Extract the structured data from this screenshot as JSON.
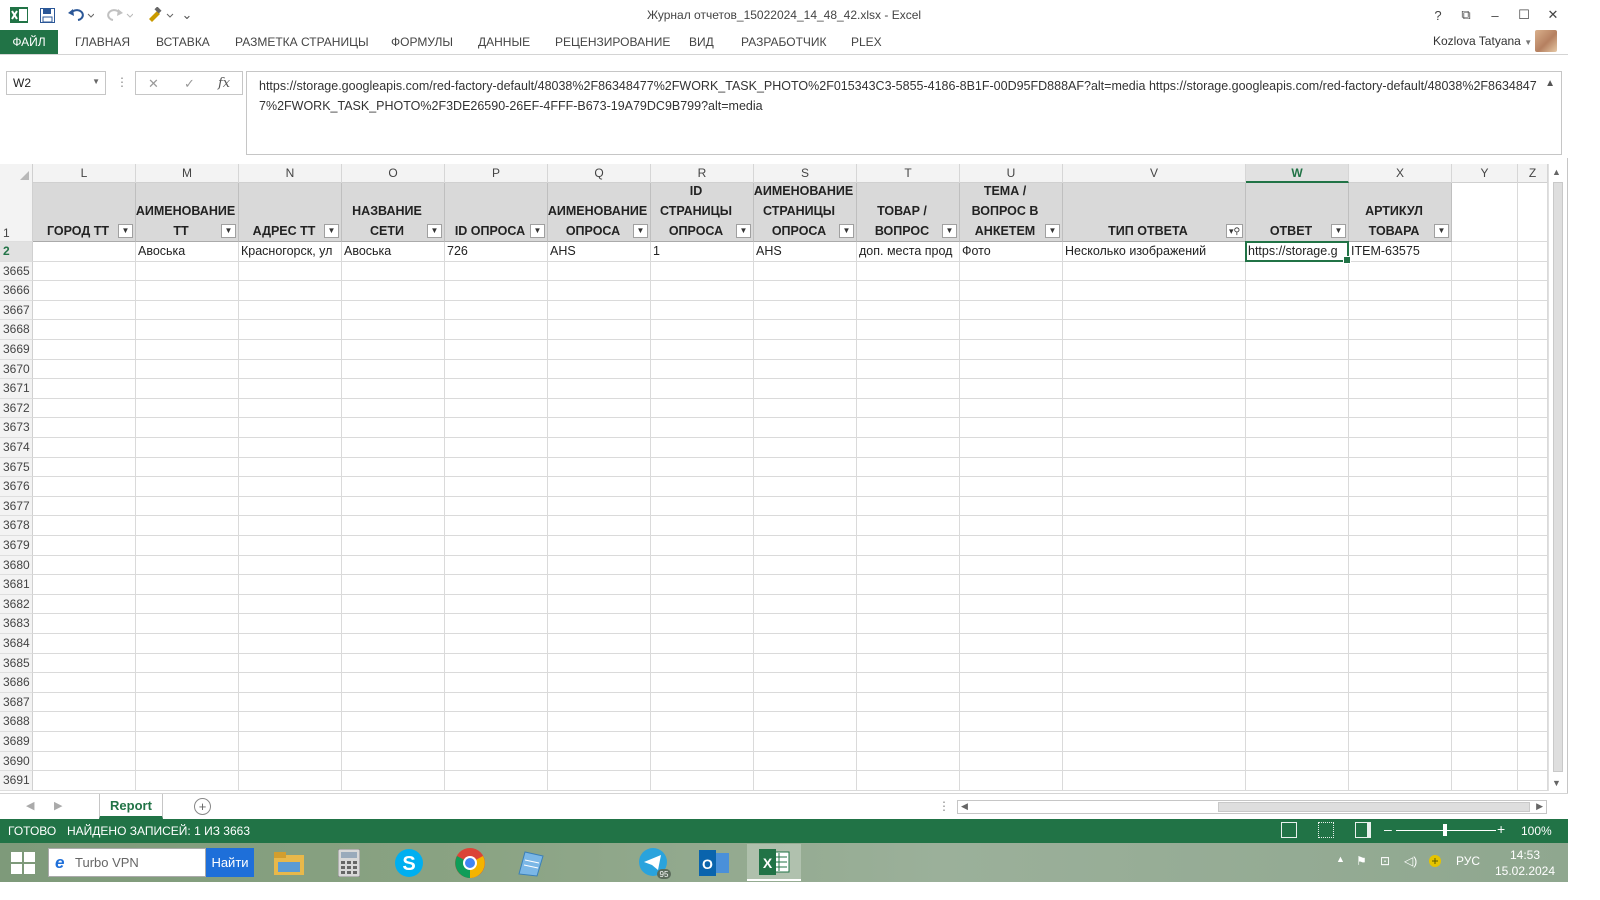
{
  "window": {
    "title": "Журнал отчетов_15022024_14_48_42.xlsx - Excel",
    "help": "?",
    "controls": {
      "restore_ribbon": "⧉",
      "minimize": "–",
      "maximize": "☐",
      "close": "✕"
    }
  },
  "quick_access": {
    "save": "save-icon",
    "undo": "undo-icon",
    "redo": "redo-icon",
    "format_painter": "format-painter-icon",
    "customize": "⌄"
  },
  "ribbon": {
    "file": "ФАЙЛ",
    "tabs": [
      "ГЛАВНАЯ",
      "ВСТАВКА",
      "РАЗМЕТКА СТРАНИЦЫ",
      "ФОРМУЛЫ",
      "ДАННЫЕ",
      "РЕЦЕНЗИРОВАНИЕ",
      "ВИД",
      "РАЗРАБОТЧИК",
      "PLEX"
    ],
    "user": "Kozlova Tatyana"
  },
  "formula_bar": {
    "name_box": "W2",
    "fx": "fx",
    "cancel": "✕",
    "enter": "✓",
    "content": "https://storage.googleapis.com/red-factory-default/48038%2F86348477%2FWORK_TASK_PHOTO%2F015343C3-5855-4186-8B1F-00D95FD888AF?alt=media https://storage.googleapis.com/red-factory-default/48038%2F86348477%2FWORK_TASK_PHOTO%2F3DE26590-26EF-4FFF-B673-19A79DC9B799?alt=media"
  },
  "grid": {
    "selected_column": "W",
    "columns": [
      "L",
      "M",
      "N",
      "O",
      "P",
      "Q",
      "R",
      "S",
      "T",
      "U",
      "V",
      "W",
      "X",
      "Y",
      "Z"
    ],
    "headers": [
      "ГОРОД ТТ",
      "НАИМЕНОВАНИЕ ТТ",
      "АДРЕС ТТ",
      "НАЗВАНИЕ СЕТИ",
      "ID ОПРОСА",
      "НАИМЕНОВАНИЕ ОПРОСА",
      "ID СТРАНИЦЫ ОПРОСА",
      "НАИМЕНОВАНИЕ СТРАНИЦЫ ОПРОСА",
      "ТОВАР / ВОПРОС",
      "ТЕМА /ВОПРОС В АНКЕТЕМ",
      "ТИП ОТВЕТА",
      "ОТВЕТ",
      "АРТИКУЛ ТОВАРА"
    ],
    "filtered_column": "ТИП ОТВЕТА",
    "data_row": [
      "",
      "Авоська",
      "Красногорск, ул",
      "Авоська",
      "726",
      "AHS",
      "1",
      "AHS",
      "доп. места прод",
      "Фото",
      "Несколько изображений",
      "https://storage.g",
      "ITEM-63575"
    ],
    "row_numbers": [
      "1",
      "2",
      "3665",
      "3666",
      "3667",
      "3668",
      "3669",
      "3670",
      "3671",
      "3672",
      "3673",
      "3674",
      "3675",
      "3676",
      "3677",
      "3678",
      "3679",
      "3680",
      "3681",
      "3682",
      "3683",
      "3684",
      "3685",
      "3686",
      "3687",
      "3688",
      "3689",
      "3690",
      "3691"
    ]
  },
  "sheets": {
    "tabs": [
      "Report"
    ],
    "add": "+"
  },
  "status": {
    "ready": "ГОТОВО",
    "records": "НАЙДЕНО ЗАПИСЕЙ: 1 ИЗ 3663",
    "zoom": "100%",
    "zoom_minus": "–",
    "zoom_plus": "+"
  },
  "taskbar": {
    "search_placeholder": "Turbo VPN",
    "search_button": "Найти",
    "telegram_badge": "95",
    "lang": "РУС",
    "time": "14:53",
    "date": "15.02.2024"
  },
  "colors": {
    "excel_green": "#217346",
    "header_fill": "#d9d9d9",
    "taskbar": "#8aa383"
  }
}
